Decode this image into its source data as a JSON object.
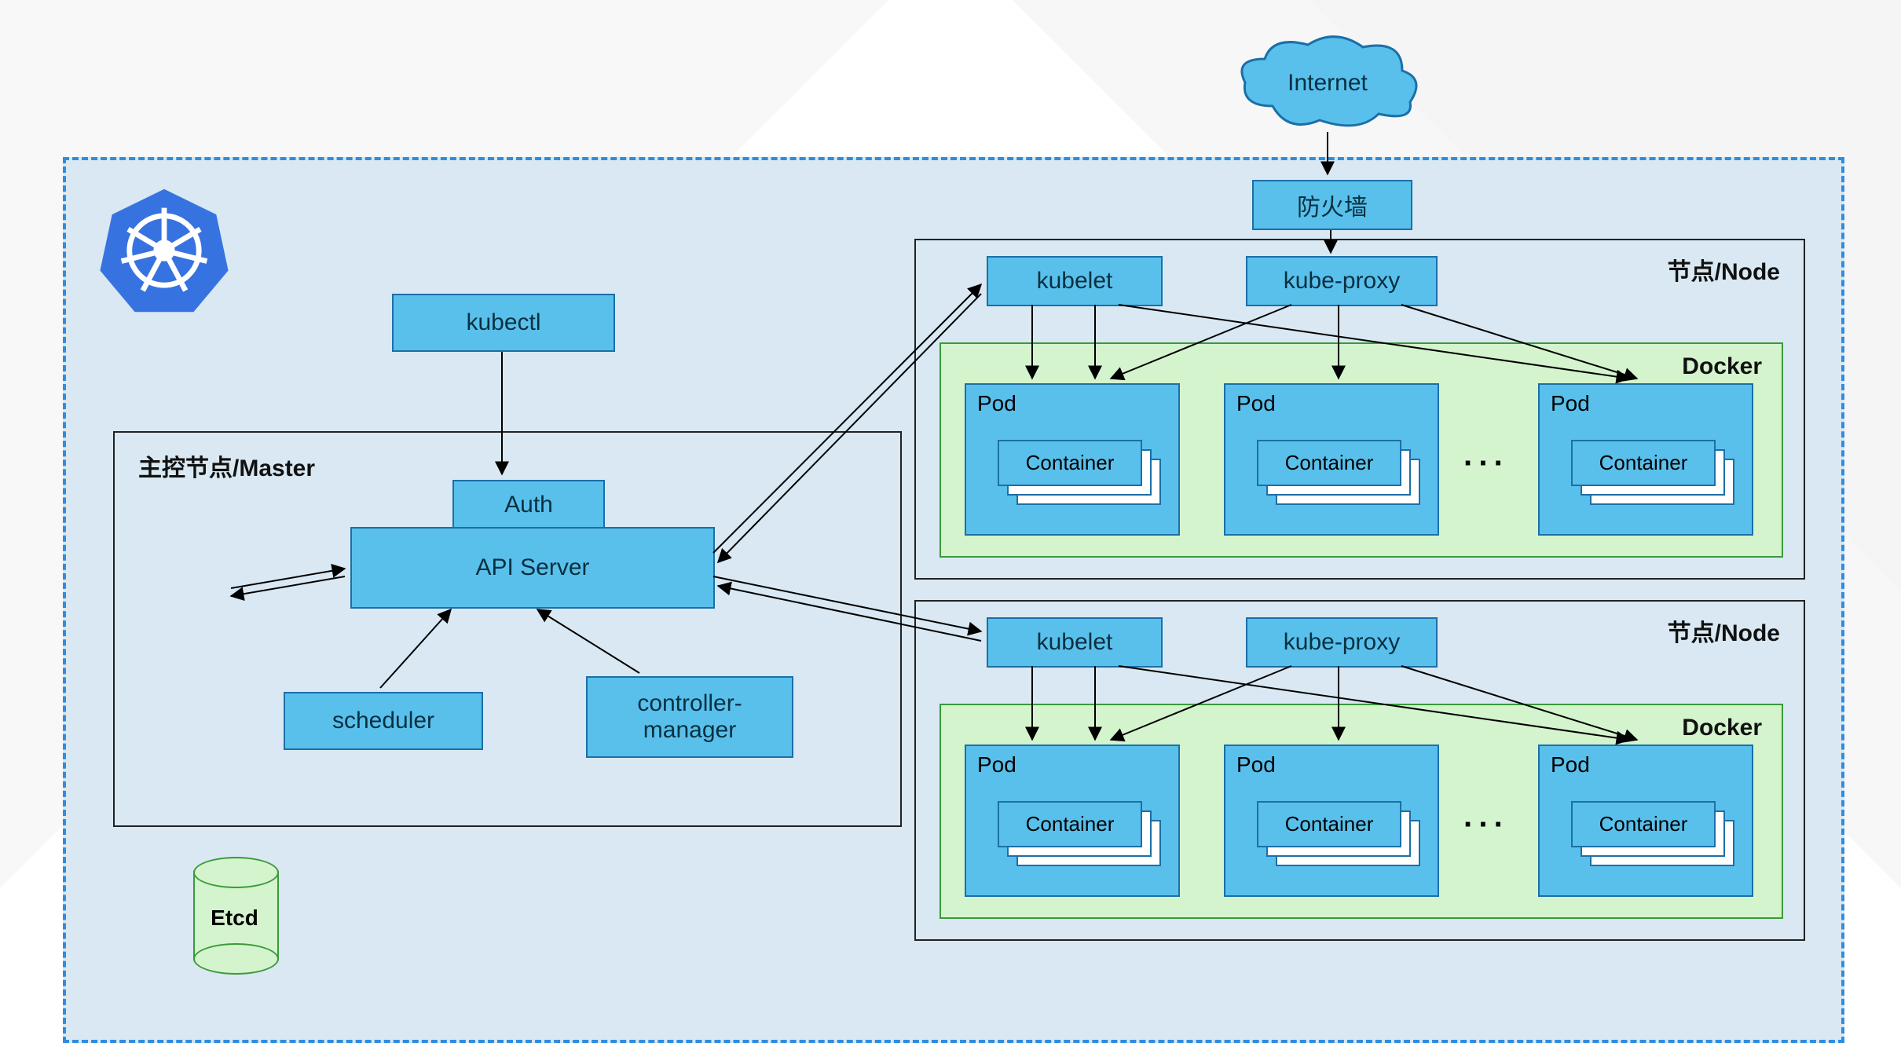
{
  "cloud_label": "Internet",
  "firewall_label": "防火墙",
  "kubectl_label": "kubectl",
  "master": {
    "title": "主控节点/Master",
    "auth": "Auth",
    "api_server": "API Server",
    "etcd": "Etcd",
    "scheduler": "scheduler",
    "controller_manager": "controller-\nmanager"
  },
  "node_title": "节点/Node",
  "kubelet_label": "kubelet",
  "kube_proxy_label": "kube-proxy",
  "docker_label": "Docker",
  "pod_label": "Pod",
  "container_label": "Container",
  "ellipsis": "···",
  "colors": {
    "box_fill": "#59c0ec",
    "box_border": "#1b6fa8",
    "cluster_border": "#2e8de0",
    "cluster_fill": "#d9e8f2",
    "green_fill": "#d4f4cd",
    "green_border": "#3a9a3a",
    "logo": "#3773e0"
  }
}
